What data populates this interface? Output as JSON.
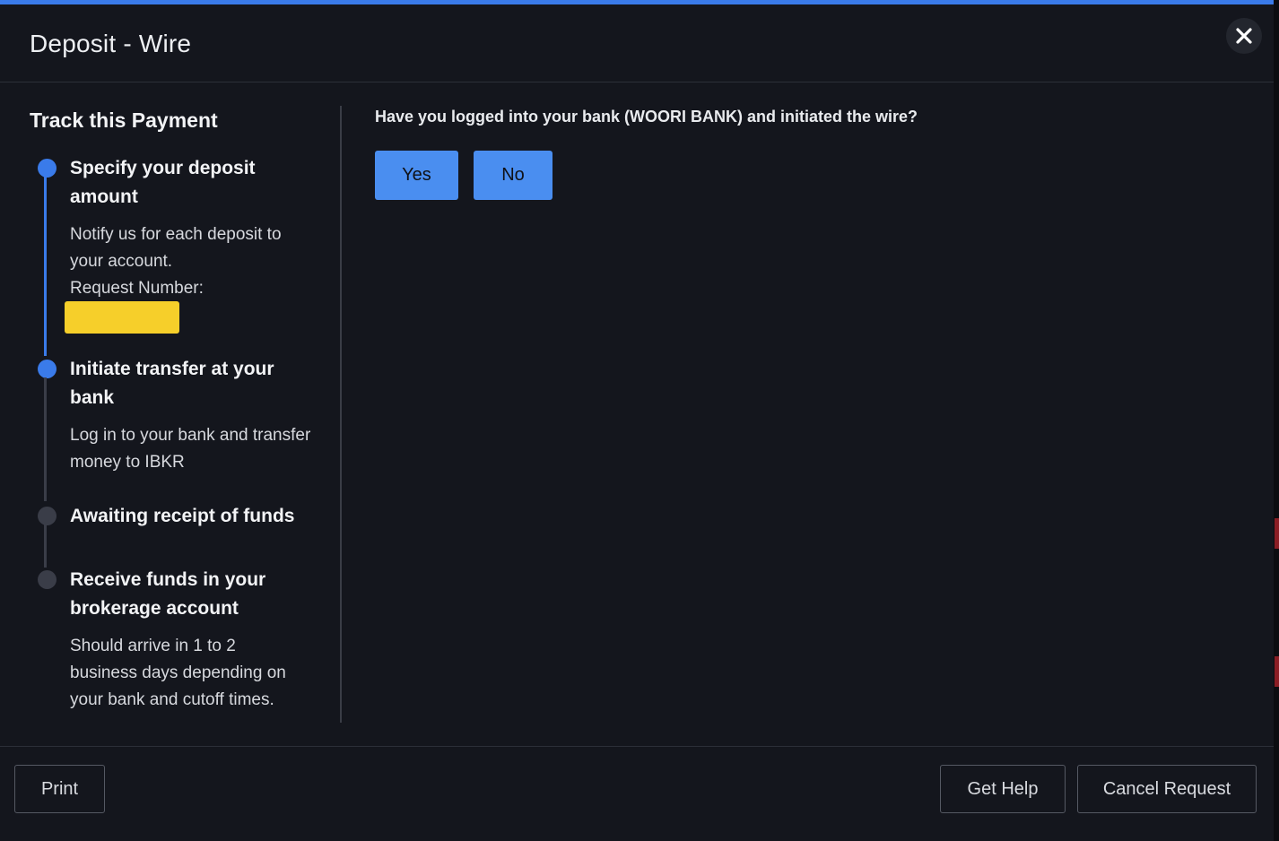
{
  "dialog": {
    "title": "Deposit - Wire",
    "accent_color": "#3a7bea"
  },
  "sidebar": {
    "heading": "Track this Payment",
    "steps": [
      {
        "title": "Specify your deposit amount",
        "description": "Notify us for each deposit to your account.",
        "extra_label": "Request Number:",
        "status": "active"
      },
      {
        "title": "Initiate transfer at your bank",
        "description": "Log in to your bank and transfer money to IBKR",
        "status": "active"
      },
      {
        "title": "Awaiting receipt of funds",
        "status": "inactive"
      },
      {
        "title": "Receive funds in your brokerage account",
        "description": "Should arrive in 1 to 2 business days depending on your bank and cutoff times.",
        "status": "inactive"
      }
    ]
  },
  "main": {
    "question": "Have you logged into your bank (WOORI BANK) and initiated the wire?",
    "yes_label": "Yes",
    "no_label": "No"
  },
  "footer": {
    "print_label": "Print",
    "help_label": "Get Help",
    "cancel_label": "Cancel Request"
  },
  "icons": {
    "close": "close-icon"
  }
}
